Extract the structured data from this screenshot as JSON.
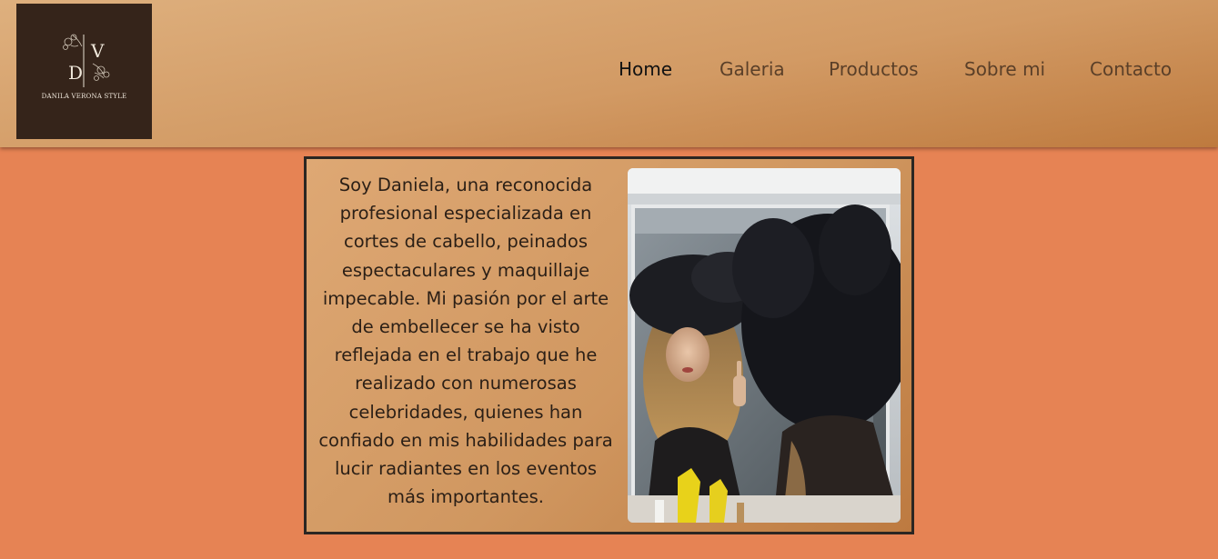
{
  "brand": {
    "logo_monogram": "DV",
    "logo_caption": "DANILA VERONA STYLE"
  },
  "nav": {
    "items": [
      {
        "label": "Home",
        "active": true
      },
      {
        "label": "Galeria",
        "active": false
      },
      {
        "label": "Productos",
        "active": false
      },
      {
        "label": "Sobre mi",
        "active": false
      },
      {
        "label": "Contacto",
        "active": false
      }
    ]
  },
  "main": {
    "bio_text": "Soy Daniela, una reconocida profesional especializada en cortes de cabello, peinados espectaculares y maquillaje impecable. Mi pasión por el arte de embellecer se ha visto reflejada en el trabajo que he realizado con numerosas celebridades, quienes han confiado en mis habilidades para lucir radiantes en los eventos más importantes.",
    "photo_icon": "portrait-photo"
  },
  "colors": {
    "page_background": "#e68354",
    "header_top": "#deb07e",
    "header_bottom": "#be7a3e",
    "logo_background": "#35241a",
    "card_border": "#2b2622",
    "nav_text": "#5a3f28",
    "nav_active_text": "#111111"
  }
}
